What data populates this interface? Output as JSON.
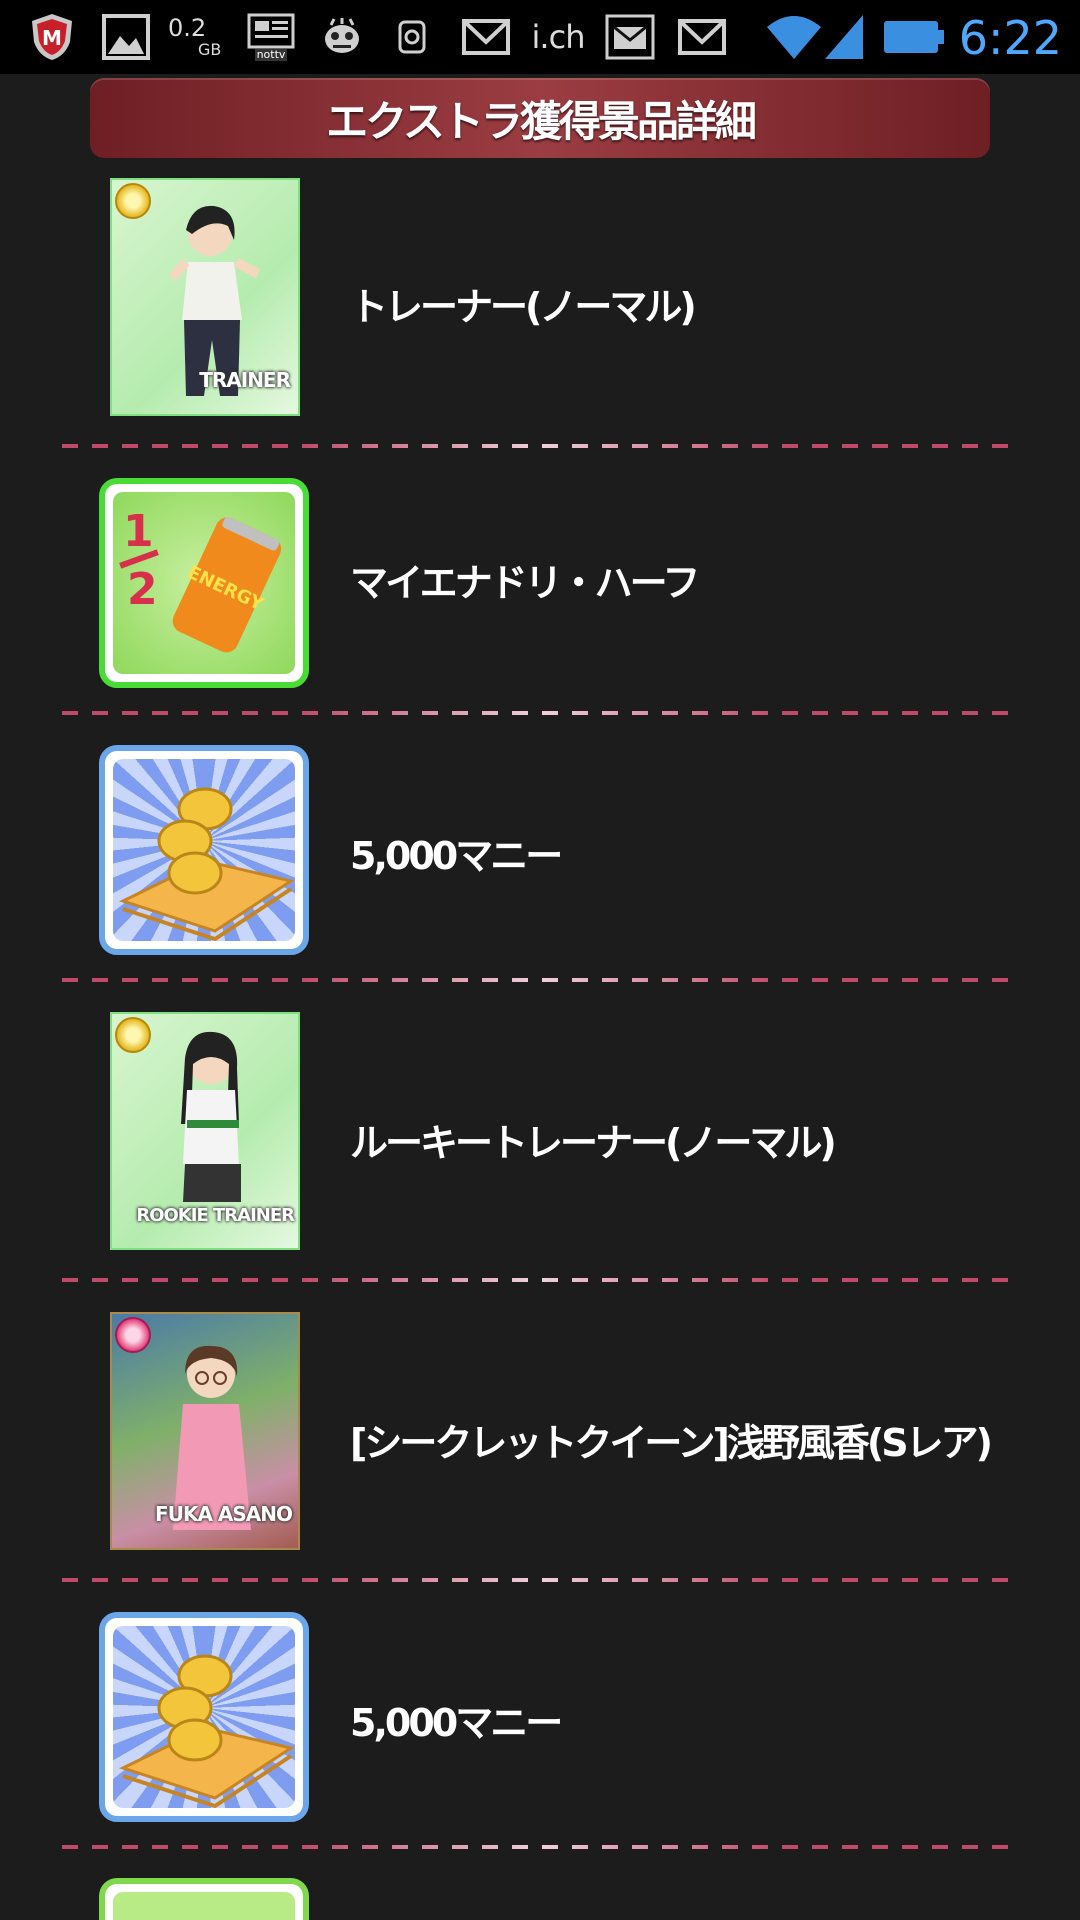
{
  "status_bar": {
    "storage_value": "0.2",
    "storage_unit": "GB",
    "app_badge": "nottv",
    "ich_label": "i.ch",
    "time": "6:22"
  },
  "header": {
    "title": "エクストラ獲得景品詳細"
  },
  "prizes": [
    {
      "label": "トレーナー(ノーマル)",
      "image_caption": "TRAINER",
      "icon": "trainer-card-icon"
    },
    {
      "label": "マイエナドリ・ハーフ",
      "image_caption": "ENERGY",
      "icon": "energy-drink-half-icon",
      "image_mark": "1/2"
    },
    {
      "label": "5,000マニー",
      "icon": "money-coins-icon"
    },
    {
      "label": "ルーキートレーナー(ノーマル)",
      "image_caption": "ROOKIE TRAINER",
      "icon": "rookie-trainer-card-icon"
    },
    {
      "label": "[シークレットクイーン]浅野風香(Sレア)",
      "image_caption": "FUKA ASANO",
      "icon": "fuka-asano-card-icon"
    },
    {
      "label": "5,000マニー",
      "icon": "money-coins-icon"
    }
  ]
}
